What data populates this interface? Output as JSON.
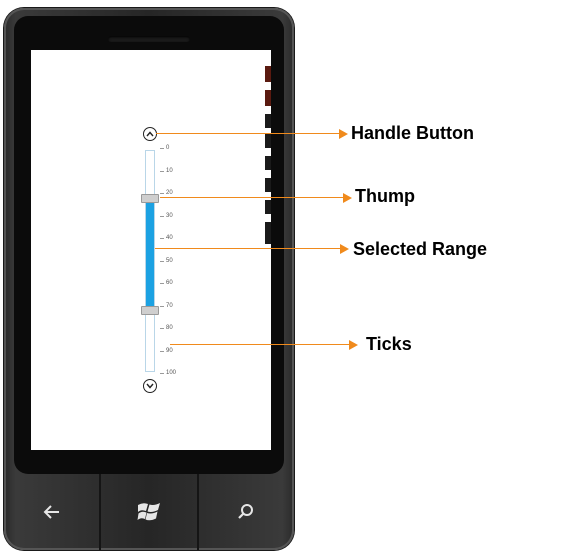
{
  "slider": {
    "min": 0,
    "max": 100,
    "range_start": 22,
    "range_end": 72,
    "ticks": [
      "0",
      "10",
      "20",
      "30",
      "40",
      "50",
      "60",
      "70",
      "80",
      "90",
      "100"
    ],
    "up_icon": "chevron-up-circle-icon",
    "down_icon": "chevron-down-circle-icon",
    "accent_color": "#1ba1e2"
  },
  "callouts": {
    "handle_button": "Handle Button",
    "thump": "Thump",
    "selected_range": "Selected Range",
    "ticks": "Ticks",
    "arrow_color": "#f08a1c"
  },
  "hardware_buttons": {
    "back": "back-arrow-icon",
    "start": "windows-logo-icon",
    "search": "search-icon"
  }
}
